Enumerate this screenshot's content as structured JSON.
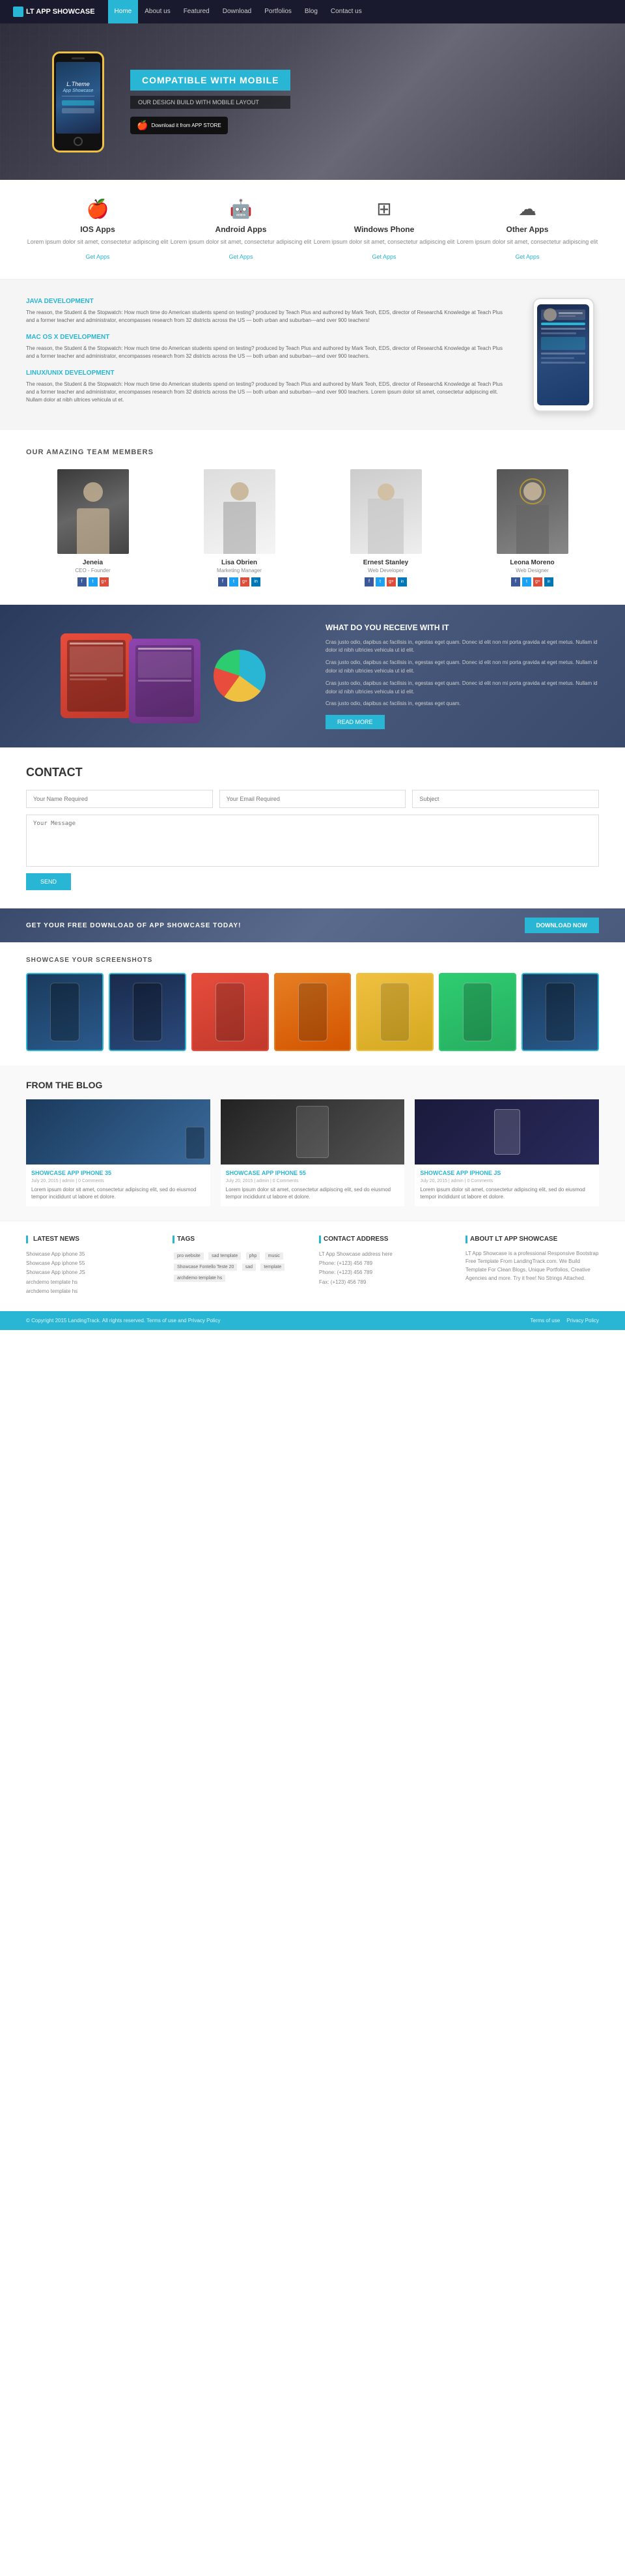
{
  "header": {
    "logo": "LT APP SHOWCASE",
    "nav": [
      "Home",
      "About us",
      "Featured",
      "Download",
      "Portfolios",
      "Blog",
      "Contact us"
    ]
  },
  "hero": {
    "phone_title": "L.Theme",
    "phone_subtitle": "App Showcase",
    "badge": "COMPATIBLE WITH MOBILE",
    "sub": "OUR DESIGN BUILD WITH MOBILE LAYOUT",
    "appstore": "Download it from APP STORE"
  },
  "apps": [
    {
      "icon": "🍎",
      "title": "IOS Apps",
      "desc": "Lorem ipsum dolor sit amet, consectetur adipiscing elit",
      "link": "Get Apps"
    },
    {
      "icon": "🤖",
      "title": "Android Apps",
      "desc": "Lorem ipsum dolor sit amet, consectetur adipiscing elit",
      "link": "Get Apps"
    },
    {
      "icon": "⊞",
      "title": "Windows Phone",
      "desc": "Lorem ipsum dolor sit amet, consectetur adipiscing elit",
      "link": "Get Apps"
    },
    {
      "icon": "☁",
      "title": "Other Apps",
      "desc": "Lorem ipsum dolor sit amet, consectetur adipiscing elit",
      "link": "Get Apps"
    }
  ],
  "dev": {
    "section1_title": "JAVA DEVELOPMENT",
    "section1_text": "The reason, the Student & the Stopwatch: How much time do American students spend on testing? produced by Teach Plus and authored by Mark Teoh, EDS, director of Research& Knowledge at Teach Plus and a former teacher and administrator, encompasses research from 32 districts across the US — both urban and suburban—and over 900 teachers!",
    "section2_title": "MAC OS X DEVELOPMENT",
    "section2_text": "The reason, the Student & the Stopwatch: How much time do American students spend on testing? produced by Teach Plus and authored by Mark Teoh, EDS, director of Research& Knowledge at Teach Plus and a former teacher and administrator, encompasses research from 32 districts across the US — both urban and suburban—and over 900 teachers.",
    "section3_title": "LINUX/UNIX DEVELOPMENT",
    "section3_text": "The reason, the Student & the Stopwatch: How much time do American students spend on testing? produced by Teach Plus and authored by Mark Teoh, EDS, director of Research& Knowledge at Teach Plus and a former teacher and administrator, encompasses research from 32 districts across the US — both urban and suburban—and over 900 teachers. Lorem ipsum dolor sit amet, consectetur adipiscing elit. Nullam dolor at nibh ultrices vehicula ut et."
  },
  "team": {
    "title": "OUR AMAZING TEAM MEMBERS",
    "members": [
      {
        "name": "Jeneia",
        "role": "CEO - Founder"
      },
      {
        "name": "Lisa Obrien",
        "role": "Marketing Manager"
      },
      {
        "name": "Ernest Stanley",
        "role": "Web Developer"
      },
      {
        "name": "Leona Moreno",
        "role": "Web Designer"
      }
    ]
  },
  "what_you_receive": {
    "title": "WHAT DO YOU RECEIVE WITH IT",
    "paragraphs": [
      "Cras justo odio, dapibus ac facilisis in, egestas eget quam. Donec id elit non mi porta gravida at eget metus. Nullam id dolor id nibh ultricies vehicula ut id elit.",
      "Cras justo odio, dapibus ac facilisis in, egestas eget quam. Donec id elit non mi porta gravida at eget metus. Nullam id dolor id nibh ultricies vehicula ut id elit.",
      "Cras justo odio, dapibus ac facilisis in, egestas eget quam. Donec id elit non mi porta gravida at eget metus. Nullam id dolor id nibh ultricies vehicula ut id elit.",
      "Cras justo odio, dapibus ac facilisis in, egestas eget quam."
    ],
    "btn": "READ MORE"
  },
  "contact": {
    "title": "CONTACT",
    "name_placeholder": "Your Name Required",
    "email_placeholder": "Your Email Required",
    "subject_placeholder": "Subject",
    "message_placeholder": "Your Message",
    "send_btn": "SEND"
  },
  "download_banner": {
    "text": "GET YOUR FREE DOWNLOAD OF APP SHOWCASE TODAY!",
    "btn": "DOWNLOAD NOW"
  },
  "screenshots": {
    "title": "SHOWCASE YOUR SCREENSHOTS"
  },
  "blog": {
    "title": "FROM THE BLOG",
    "posts": [
      {
        "title": "SHOWCASE APP IPHONE 35",
        "meta": "July 20, 2015 | admin | 0 Comments",
        "text": "Lorem ipsum dolor sit amet, consectetur adipiscing elit, sed do eiusmod tempor incididunt ut labore et dolore."
      },
      {
        "title": "SHOWCASE APP IPHONE 55",
        "meta": "July 20, 2015 | admin | 0 Comments",
        "text": "Lorem ipsum dolor sit amet, consectetur adipiscing elit, sed do eiusmod tempor incididunt ut labore et dolore."
      },
      {
        "title": "SHOWCASE APP IPHONE JS",
        "meta": "July 20, 2015 | admin | 0 Comments",
        "text": "Lorem ipsum dolor sit amet, consectetur adipiscing elit, sed do eiusmod tempor incididunt ut labore et dolore."
      }
    ]
  },
  "footer": {
    "latest_news_title": "LATEST NEWS",
    "latest_news": [
      "Showcase App iphone 35",
      "Showcase App iphone 55",
      "Showcase App iphone JS",
      "archdemo template hs",
      "archdemo template hs"
    ],
    "tags_title": "TAGS",
    "tags": [
      "pro website",
      "sad template",
      "php",
      "music",
      "Showcase Fontello Teste 20",
      "sad",
      "template",
      "archdemo template hs"
    ],
    "contact_title": "CONTACT ADDRESS",
    "contact_info": [
      "LT App Showcase address here",
      "Phone: (+123) 456 789",
      "Phone: (+123) 456 789",
      "Fax: (+123) 456 789"
    ],
    "about_title": "ABOUT LT APP SHOWCASE",
    "about_text": "LT App Showcase is a professional Responsive Bootstrap Free Template From LandingTrack.com. We Build Template For Clean Blogs, Unique Portfolios, Creative Agencies and more. Try it free! No Strings Attached.",
    "copyright": "© Copyright 2015 LandingTrack. All rights reserved. Terms of use and Privacy Policy",
    "bottom_links": [
      "Terms of use",
      "Privacy Policy"
    ]
  }
}
